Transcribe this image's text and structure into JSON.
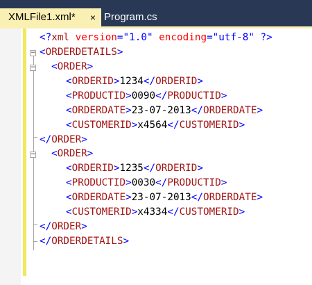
{
  "tabs": [
    {
      "label": "XMLFile1.xml*",
      "close": "×",
      "active": true
    },
    {
      "label": "Program.cs",
      "active": false
    }
  ],
  "code": {
    "decl": {
      "open": "<?",
      "name": "xml",
      "attr1": "version",
      "eq1": "=",
      "val1": "\"1.0\"",
      "attr2": "encoding",
      "eq2": "=",
      "val2": "\"utf-8\"",
      "close": "?>"
    },
    "root_tag": "ORDERDETAILS",
    "order_tag": "ORDER",
    "orders": [
      {
        "orderid": "1234",
        "productid": "0090",
        "orderdate": "23-07-2013",
        "customerid": "x4564"
      },
      {
        "orderid": "1235",
        "productid": "0030",
        "orderdate": "23-07-2013",
        "customerid": "x4334"
      }
    ],
    "field_tags": {
      "orderid": "ORDERID",
      "productid": "PRODUCTID",
      "orderdate": "ORDERDATE",
      "customerid": "CUSTOMERID"
    }
  }
}
